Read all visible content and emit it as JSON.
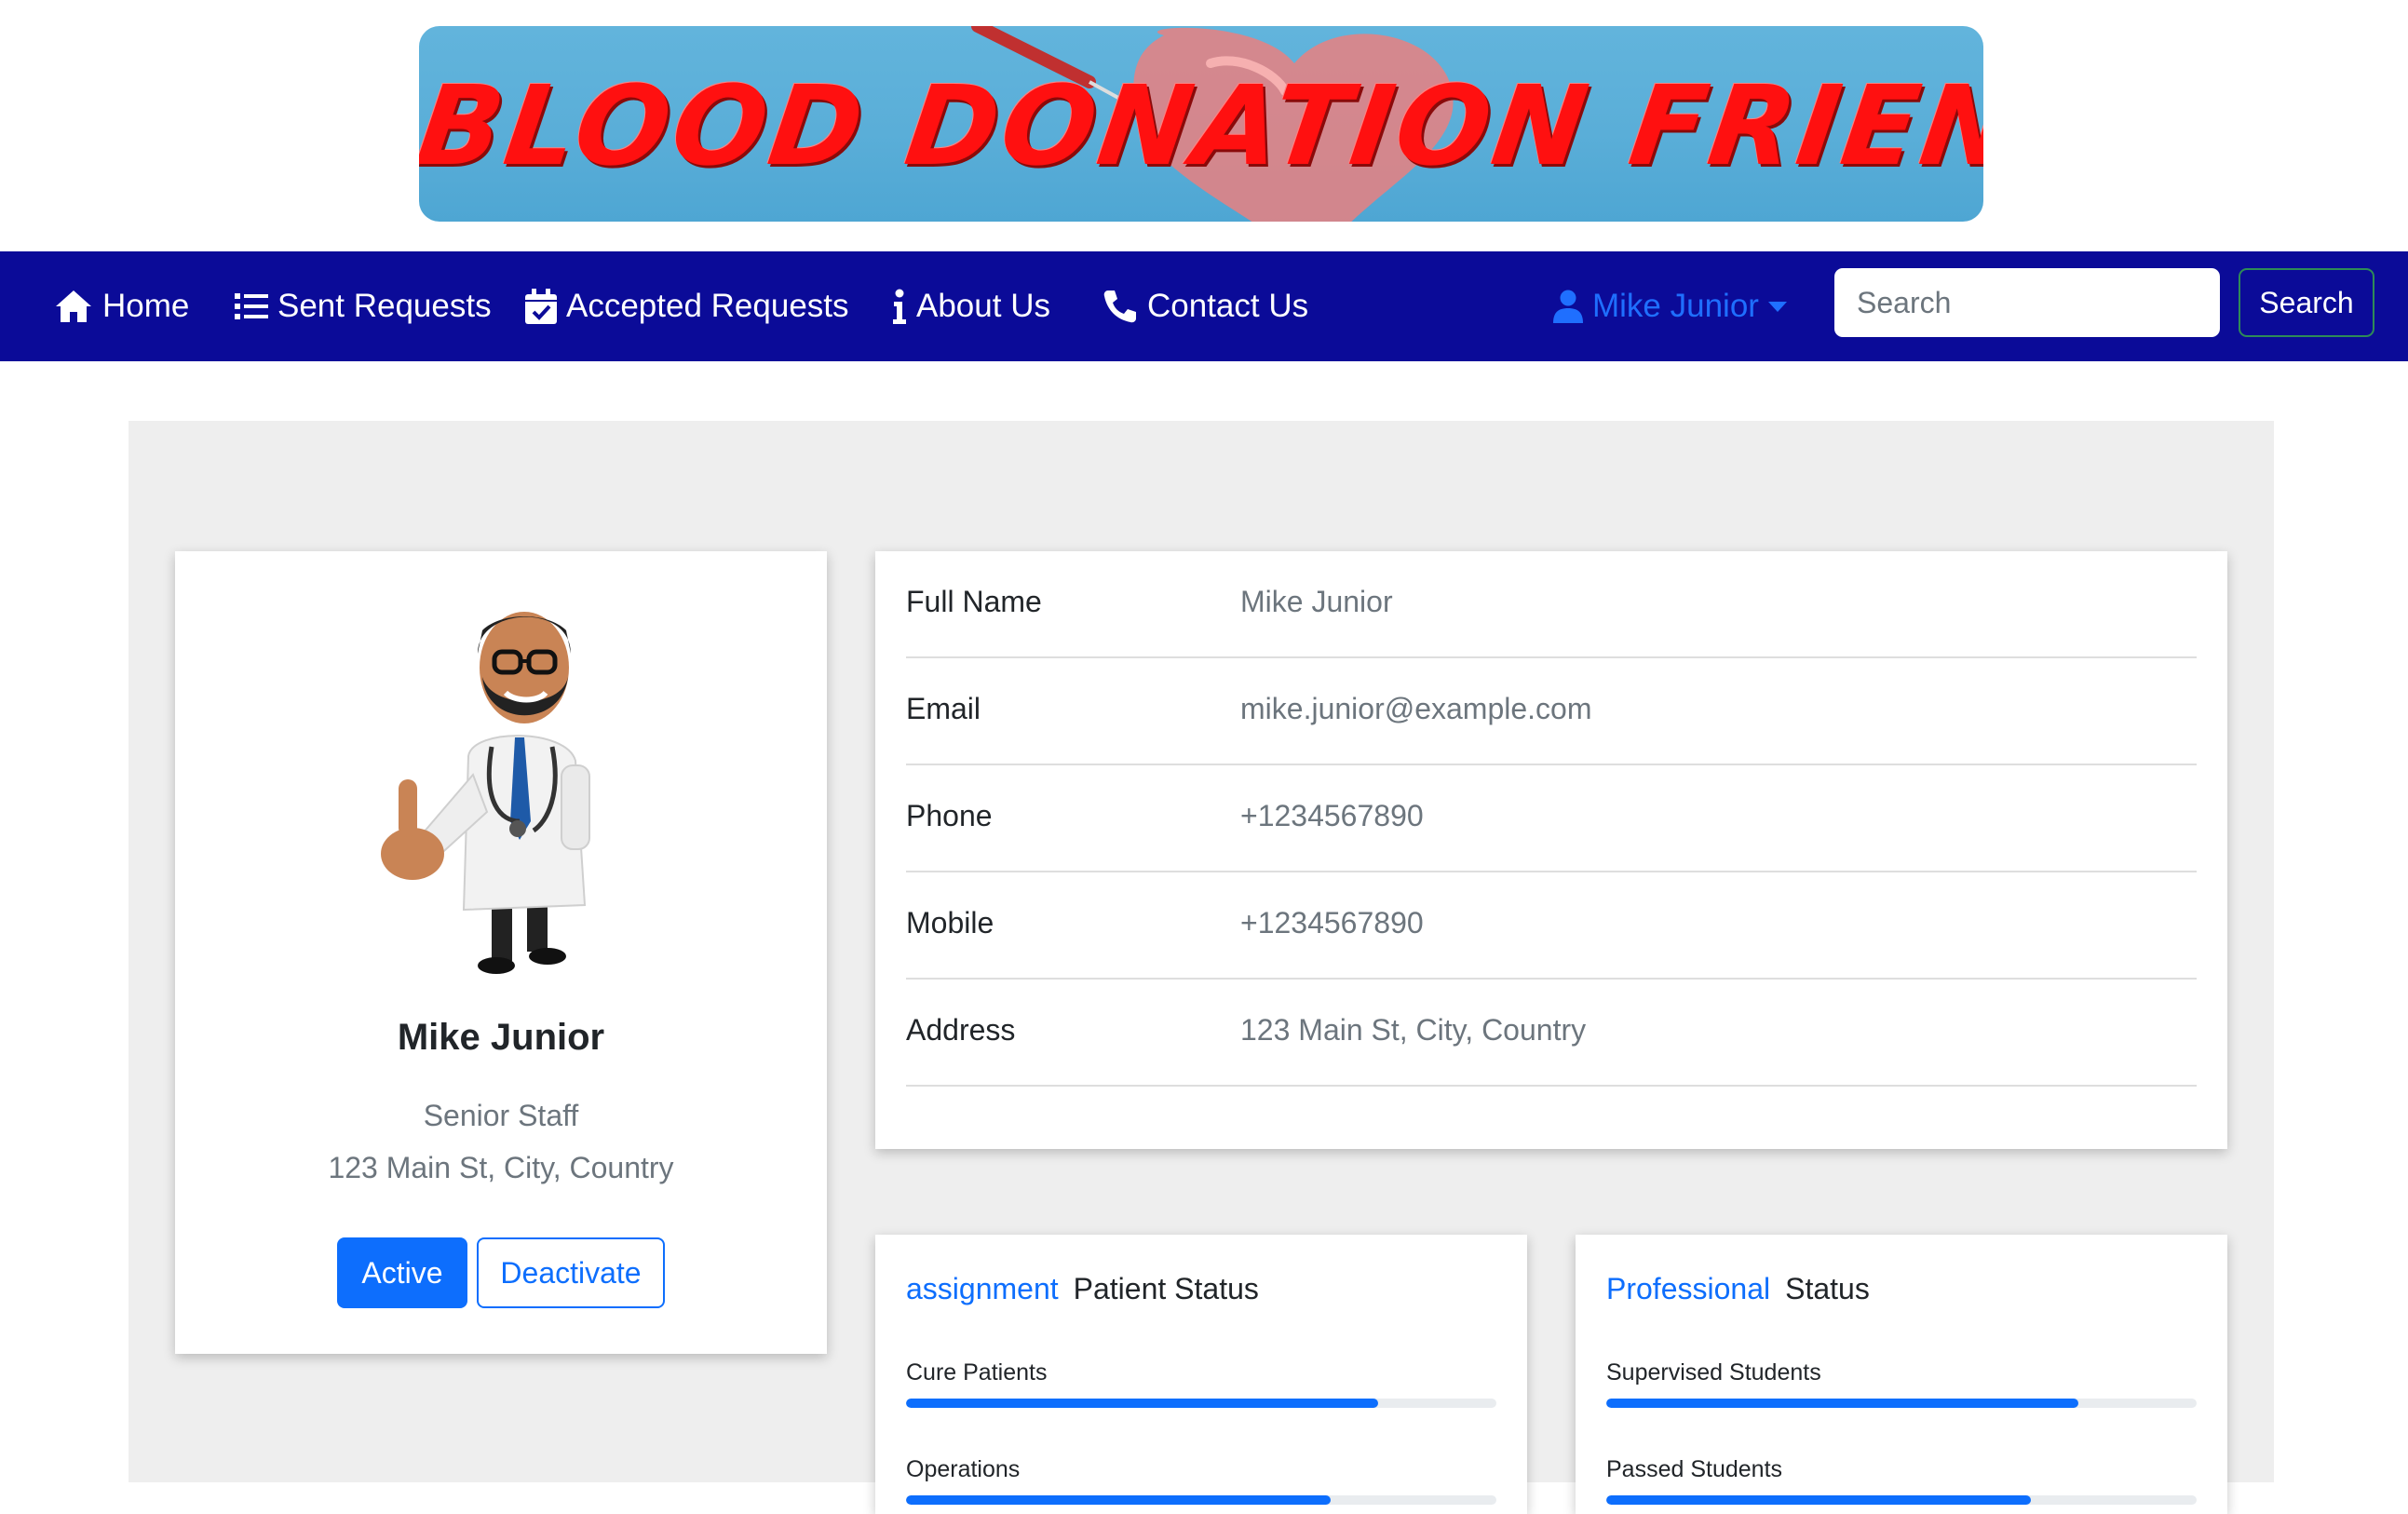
{
  "banner": {
    "title": "BLOOD DONATION FRIEND"
  },
  "nav": {
    "items": [
      {
        "label": "Home",
        "icon": "home-icon"
      },
      {
        "label": "Sent Requests",
        "icon": "list-icon"
      },
      {
        "label": "Accepted Requests",
        "icon": "calendar-check-icon"
      },
      {
        "label": "About Us",
        "icon": "info-icon"
      },
      {
        "label": "Contact Us",
        "icon": "phone-icon"
      }
    ],
    "user": {
      "name": "Mike Junior",
      "icon": "user-icon"
    },
    "search_placeholder": "Search",
    "search_button": "Search"
  },
  "profile": {
    "name": "Mike Junior",
    "role": "Senior Staff",
    "address": "123 Main St, City, Country",
    "active_label": "Active",
    "deactivate_label": "Deactivate"
  },
  "details": [
    {
      "label": "Full Name",
      "value": "Mike Junior"
    },
    {
      "label": "Email",
      "value": "mike.junior@example.com"
    },
    {
      "label": "Phone",
      "value": "+1234567890"
    },
    {
      "label": "Mobile",
      "value": "+1234567890"
    },
    {
      "label": "Address",
      "value": "123 Main St, City, Country"
    }
  ],
  "patient_status": {
    "accent": "assignment",
    "title": "Patient Status",
    "bars": [
      {
        "label": "Cure Patients",
        "percent": 80
      },
      {
        "label": "Operations",
        "percent": 72
      }
    ]
  },
  "professional_status": {
    "accent": "Professional",
    "title": "Status",
    "bars": [
      {
        "label": "Supervised Students",
        "percent": 80
      },
      {
        "label": "Passed Students",
        "percent": 72
      }
    ]
  },
  "colors": {
    "navbar": "#0b0b98",
    "primary": "#0d6efd",
    "banner_text": "#ff1010"
  }
}
